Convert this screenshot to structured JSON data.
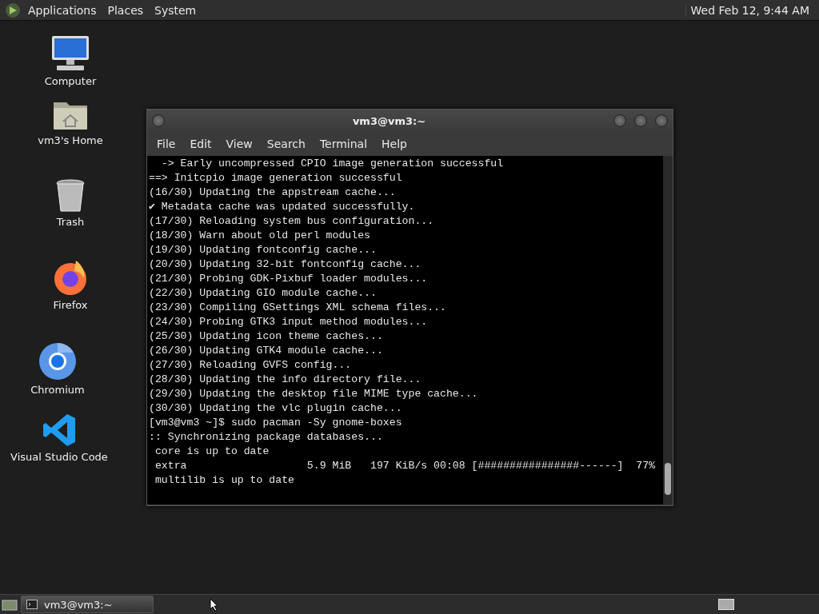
{
  "top_panel": {
    "menus": [
      "Applications",
      "Places",
      "System"
    ],
    "clock": "Wed Feb 12,  9:44 AM"
  },
  "desktop_icons": [
    {
      "label": "Computer",
      "kind": "computer"
    },
    {
      "label": "vm3's Home",
      "kind": "home"
    },
    {
      "label": "Trash",
      "kind": "trash"
    },
    {
      "label": "Firefox",
      "kind": "firefox"
    },
    {
      "label": "Chromium",
      "kind": "chromium"
    },
    {
      "label": "Visual Studio Code",
      "kind": "vscode"
    }
  ],
  "terminal": {
    "title": "vm3@vm3:~",
    "menu": [
      "File",
      "Edit",
      "View",
      "Search",
      "Terminal",
      "Help"
    ],
    "lines": [
      "  -> Early uncompressed CPIO image generation successful",
      "==> Initcpio image generation successful",
      "(16/30) Updating the appstream cache...",
      "✔ Metadata cache was updated successfully.",
      "(17/30) Reloading system bus configuration...",
      "(18/30) Warn about old perl modules",
      "(19/30) Updating fontconfig cache...",
      "(20/30) Updating 32-bit fontconfig cache...",
      "(21/30) Probing GDK-Pixbuf loader modules...",
      "(22/30) Updating GIO module cache...",
      "(23/30) Compiling GSettings XML schema files...",
      "(24/30) Probing GTK3 input method modules...",
      "(25/30) Updating icon theme caches...",
      "(26/30) Updating GTK4 module cache...",
      "(27/30) Reloading GVFS config...",
      "(28/30) Updating the info directory file...",
      "(29/30) Updating the desktop file MIME type cache...",
      "(30/30) Updating the vlc plugin cache...",
      "[vm3@vm3 ~]$ sudo pacman -Sy gnome-boxes",
      ":: Synchronizing package databases...",
      " core is up to date",
      " extra                   5.9 MiB   197 KiB/s 00:08 [################------]  77%",
      " multilib is up to date"
    ]
  },
  "taskbar": {
    "tasks": [
      {
        "label": "vm3@vm3:~",
        "selected": true
      }
    ]
  }
}
